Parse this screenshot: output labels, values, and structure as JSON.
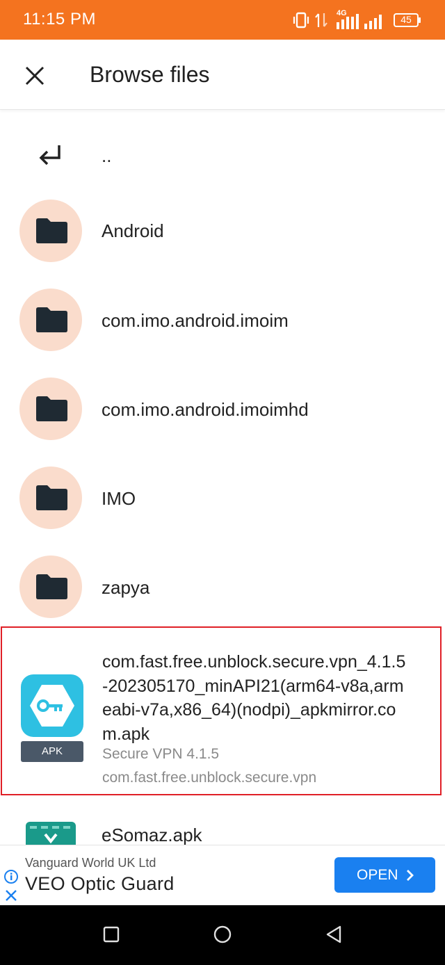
{
  "status_bar": {
    "time": "11:15 PM",
    "network": "4G",
    "battery": "45",
    "bg_color": "#f4731f"
  },
  "app_bar": {
    "close_icon": "close-icon",
    "title": "Browse files"
  },
  "file_list": {
    "parent": {
      "icon": "return-arrow-icon",
      "label": ".."
    },
    "folders": [
      {
        "name": "Android"
      },
      {
        "name": "com.imo.android.imoim"
      },
      {
        "name": "com.imo.android.imoimhd"
      },
      {
        "name": "IMO"
      },
      {
        "name": "zapya"
      }
    ],
    "selected_apk": {
      "filename": "com.fast.free.unblock.secure.vpn_4.1.5-202305170_minAPI21(arm64-v8a,armeabi-v7a,x86_64)(nodpi)_apkmirror.com.apk",
      "app_label": "Secure VPN 4.1.5",
      "package": "com.fast.free.unblock.secure.vpn",
      "badge": "APK",
      "highlight_color": "#e01f26"
    },
    "next_file": {
      "name": "eSomaz.apk"
    }
  },
  "ad": {
    "advertiser": "Vanguard World UK Ltd",
    "title": "VEO Optic Guard",
    "button_label": "OPEN",
    "button_color": "#1a80f0"
  },
  "nav_bar": {
    "buttons": [
      "recents-square-icon",
      "home-circle-icon",
      "back-triangle-icon"
    ]
  }
}
